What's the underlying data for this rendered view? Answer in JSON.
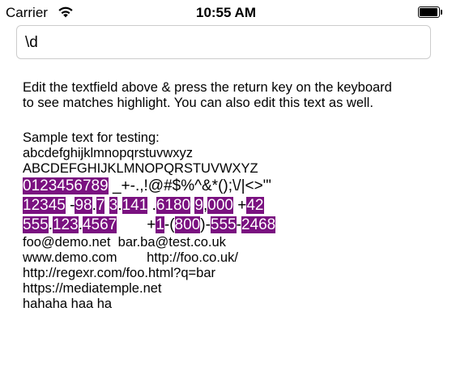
{
  "status_bar": {
    "carrier": "Carrier",
    "time": "10:55 AM",
    "wifi_icon": "wifi-icon",
    "battery_icon": "battery-full-icon"
  },
  "search_field": {
    "value": "\\d",
    "placeholder": ""
  },
  "content": {
    "instructions_line1": "Edit the textfield above & press the return key on the keyboard",
    "instructions_line2": "to see matches highlight. You can also edit this text as well.",
    "sample_heading": "Sample text for testing:",
    "lowercase": "abcdefghijklmnopqrstuvwxyz",
    "uppercase": "ABCDEFGHIJKLMNOPQRSTUVWXYZ",
    "digits_line": {
      "match": "0123456789",
      "rest": " _+-.,!@#$%^&*();\\/|<>\"'"
    },
    "line_numbers_1": [
      "12345",
      " -",
      "98",
      ".",
      "7",
      " ",
      "3",
      ".",
      "141",
      " .",
      "6180",
      " ",
      "9",
      ",",
      "000",
      " +",
      "42"
    ],
    "line_numbers_2": [
      "555",
      ".",
      "123",
      ".",
      "4567",
      "       +",
      "1",
      "-(",
      "800",
      ")-",
      "555",
      "-",
      "2468"
    ],
    "email_line": "foo@demo.net  bar.ba@test.co.uk",
    "web_line": "www.demo.com        http://foo.co.uk/",
    "regexr_line": "http://regexr.com/foo.html?q=bar",
    "mediatemple_line": "https://mediatemple.net",
    "haha_line": "hahaha haa ha"
  },
  "colors": {
    "highlight": "#7a1180",
    "highlight_text": "#ffffff",
    "field_border": "#cccccc"
  }
}
